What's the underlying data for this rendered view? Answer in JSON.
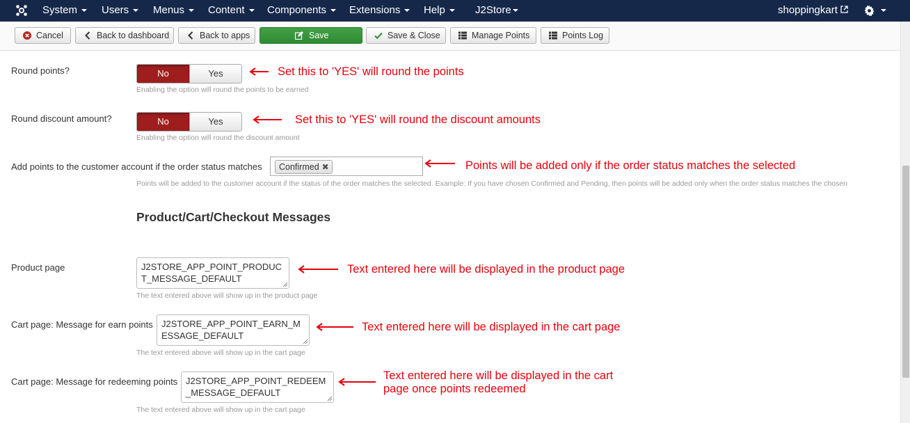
{
  "topnav": {
    "logo_icon": "joomla-icon",
    "menus": [
      "System",
      "Users",
      "Menus",
      "Content",
      "Components",
      "Extensions",
      "Help",
      "J2Store"
    ],
    "site_link": "shoppingkart",
    "settings_icon": "gear-icon"
  },
  "toolbar": {
    "cancel": "Cancel",
    "back_dashboard": "Back to dashboard",
    "back_apps": "Back to apps",
    "save": "Save",
    "save_close": "Save & Close",
    "manage_points": "Manage Points",
    "points_log": "Points Log"
  },
  "form": {
    "round_points": {
      "label": "Round points?",
      "no": "No",
      "yes": "Yes",
      "selected": "No",
      "help": "Enabling the option will round the points to be earned",
      "annotation": "Set this to 'YES' will round the points"
    },
    "round_discount": {
      "label": "Round discount amount?",
      "no": "No",
      "yes": "Yes",
      "selected": "No",
      "help": "Enabling the option will round the discount amount",
      "annotation": "Set this to 'YES' will round the discount amounts"
    },
    "order_status": {
      "label": "Add points to the customer account if the order status matches",
      "chip": "Confirmed",
      "help": "Points will be added to the customer account if the status of the order matches the selected. Example: If you have chosen Confirmed and Pending, then points will be added only when the order status matches the chosen",
      "annotation": "Points will be added only if the order status matches the selected"
    },
    "section_title": "Product/Cart/Checkout Messages",
    "product_page": {
      "label": "Product page",
      "value": "J2STORE_APP_POINT_PRODUCT_MESSAGE_DEFAULT",
      "help": "The text entered above will show up in the product page",
      "annotation": "Text entered here will be displayed in the product page"
    },
    "cart_earn": {
      "label": "Cart page: Message for earn points",
      "value": "J2STORE_APP_POINT_EARN_MESSAGE_DEFAULT",
      "help": "The text entered above will show up in the cart page",
      "annotation": "Text entered here will be displayed in the cart page"
    },
    "cart_redeem": {
      "label": "Cart page: Message for redeeming points",
      "value": "J2STORE_APP_POINT_REDEEM_MESSAGE_DEFAULT",
      "help": "The text entered above will show up in the cart page",
      "annotation_line1": "Text entered here will be displayed in the cart",
      "annotation_line2": "page once points redeemed"
    }
  },
  "colors": {
    "nav_bg": "#16284a",
    "toggle_active": "#9e1e1e",
    "save_green": "#3b9b3f",
    "annotation_red": "#e8000b"
  }
}
